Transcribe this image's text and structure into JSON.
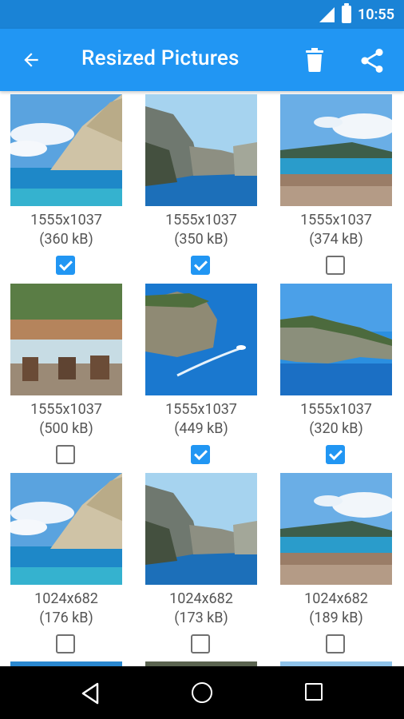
{
  "status_bar": {
    "time": "10:55"
  },
  "app_bar": {
    "title": "Resized Pictures",
    "icons": {
      "back": "arrow-back-icon",
      "delete": "trash-icon",
      "share": "share-icon"
    }
  },
  "pictures": [
    {
      "dims": "1555x1037",
      "size": "(360 kB)",
      "checked": true,
      "scene": "cliff-beach"
    },
    {
      "dims": "1555x1037",
      "size": "(350 kB)",
      "checked": true,
      "scene": "cliffs-sea"
    },
    {
      "dims": "1555x1037",
      "size": "(374 kB)",
      "checked": false,
      "scene": "harbor-town"
    },
    {
      "dims": "1555x1037",
      "size": "(500 kB)",
      "checked": false,
      "scene": "cafe-terrace"
    },
    {
      "dims": "1555x1037",
      "size": "(449 kB)",
      "checked": true,
      "scene": "boat-cliff"
    },
    {
      "dims": "1555x1037",
      "size": "(320 kB)",
      "checked": true,
      "scene": "shipwreck-bay"
    },
    {
      "dims": "1024x682",
      "size": "(176 kB)",
      "checked": false,
      "scene": "cliff-beach"
    },
    {
      "dims": "1024x682",
      "size": "(173 kB)",
      "checked": false,
      "scene": "cliffs-sea"
    },
    {
      "dims": "1024x682",
      "size": "(189 kB)",
      "checked": false,
      "scene": "harbor-town"
    }
  ],
  "colors": {
    "primary": "#2196f3",
    "status": "#1a83d6",
    "text_secondary": "#555555"
  },
  "nav_bar": {
    "icons": [
      "nav-back-icon",
      "nav-home-icon",
      "nav-recents-icon"
    ]
  }
}
